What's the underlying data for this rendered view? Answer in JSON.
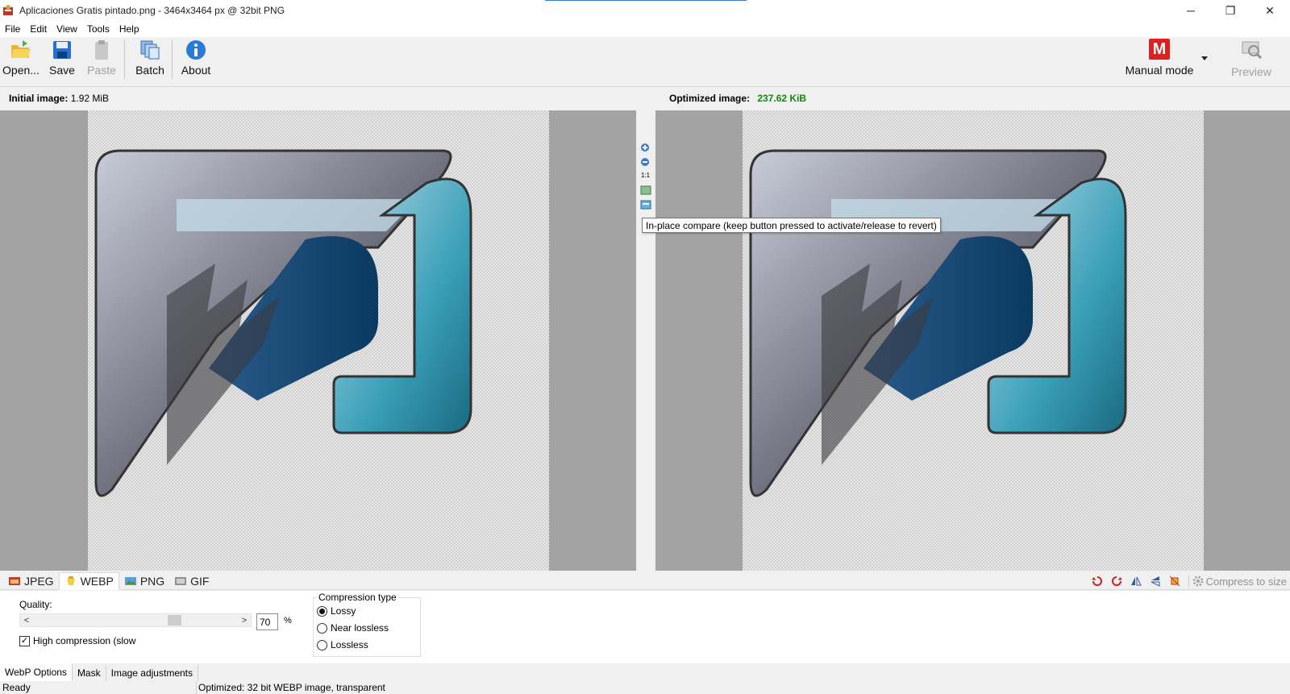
{
  "window": {
    "title": "Aplicaciones Gratis pintado.png - 3464x3464 px @ 32bit PNG",
    "minimize_glyph": "─",
    "restore_glyph": "❐",
    "close_glyph": "✕"
  },
  "menu": [
    "File",
    "Edit",
    "View",
    "Tools",
    "Help"
  ],
  "toolbar": {
    "open": "Open...",
    "save": "Save",
    "paste": "Paste",
    "batch": "Batch",
    "about": "About",
    "mode": "Manual mode",
    "mode_letter": "M",
    "preview": "Preview"
  },
  "info": {
    "initial_label": "Initial image:",
    "initial_size": "1.92 MiB",
    "optimized_label": "Optimized image:",
    "optimized_size": "237.62 KiB"
  },
  "zoom": {
    "one_to_one": "1:1"
  },
  "tooltip": "In-place compare (keep button pressed to activate/release to revert)",
  "format_tabs": [
    "JPEG",
    "WEBP",
    "PNG",
    "GIF"
  ],
  "active_format": "WEBP",
  "compress_to_size": "Compress to size",
  "options": {
    "quality_label": "Quality:",
    "quality_value": "70",
    "quality_percent": 70,
    "percent_sign": "%",
    "slider_left": "<",
    "slider_right": ">",
    "high_compression": "High compression (slow",
    "compression_type_label": "Compression type",
    "compression_types": [
      "Lossy",
      "Near lossless",
      "Lossless"
    ],
    "selected_compression": "Lossy"
  },
  "bottom_tabs": [
    "WebP Options",
    "Mask",
    "Image adjustments"
  ],
  "status": {
    "left": "Ready",
    "right": "Optimized: 32 bit WEBP image, transparent"
  },
  "colors": {
    "accent": "#3b7bd6",
    "mode_red": "#e02020",
    "optimized_green": "#0f8a0f"
  }
}
